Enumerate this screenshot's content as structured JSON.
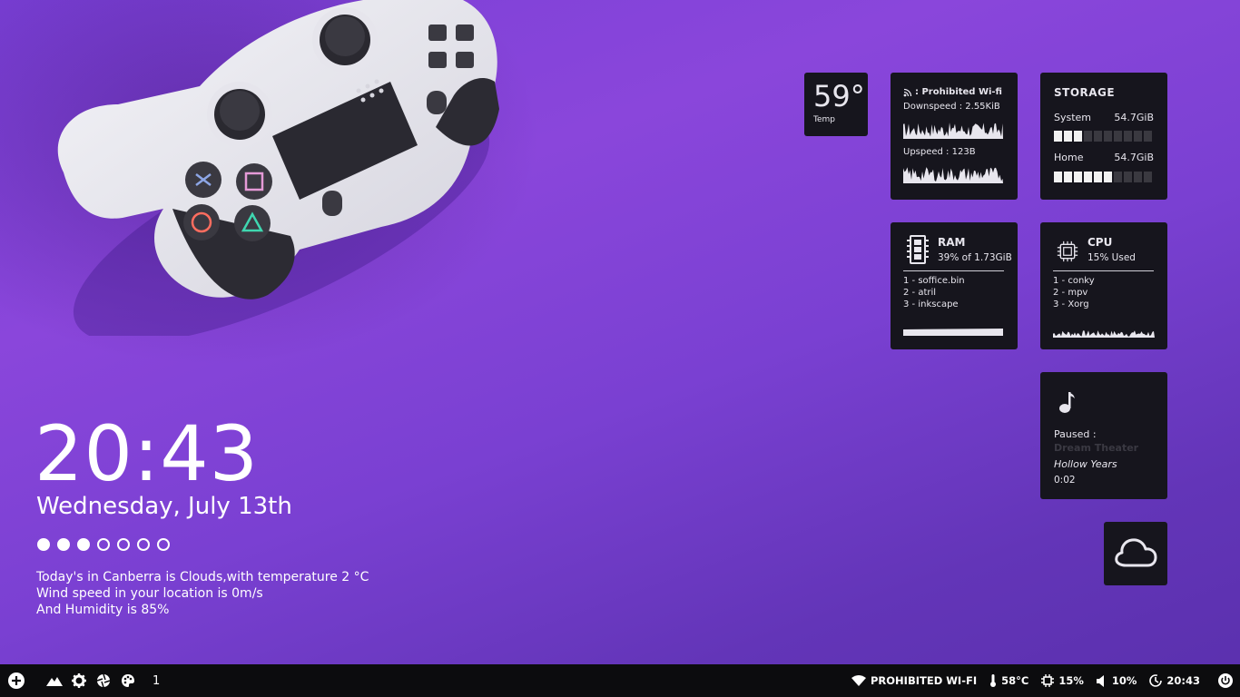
{
  "clock": {
    "time": "20:43",
    "date": "Wednesday, July 13th",
    "workspace_dots": [
      true,
      true,
      true,
      false,
      false,
      false,
      false
    ]
  },
  "weather_text": {
    "line1": "Today's in Canberra is Clouds,with temperature 2 °C",
    "line2": "Wind speed in your location is 0m/s",
    "line3": "And Humidity is 85%"
  },
  "temp_widget": {
    "value": "59°",
    "label": "Temp"
  },
  "network": {
    "ssid_label": ": Prohibited Wi-fi",
    "downspeed": "Downspeed : 2.55KiB",
    "upspeed": "Upspeed : 123B",
    "icon": "rss-wifi-icon"
  },
  "storage": {
    "title": "STORAGE",
    "system": {
      "label": "System",
      "value": "54.7GiB",
      "filled_segments": 3,
      "total_segments": 10
    },
    "home": {
      "label": "Home",
      "value": "54.7GiB",
      "filled_segments": 6,
      "total_segments": 10
    }
  },
  "ram": {
    "title": "RAM",
    "usage": "39% of 1.73GiB",
    "processes": [
      "1 - soffice.bin",
      "2 - atril",
      "3 - inkscape"
    ],
    "icon": "memory-icon"
  },
  "cpu": {
    "title": "CPU",
    "usage": "15% Used",
    "processes": [
      "1 - conky",
      "2 - mpv",
      "3 - Xorg"
    ],
    "icon": "chip-icon"
  },
  "music": {
    "status": "Paused :",
    "artist": "Dream Theater",
    "song": "Hollow Years",
    "time": "0:02",
    "icon": "music-note-icon"
  },
  "weather_widget": {
    "icon": "cloud-icon"
  },
  "taskbar": {
    "left_icons": [
      "add-circle-icon",
      "mountain-icon",
      "gear-icon",
      "aperture-icon",
      "palette-icon"
    ],
    "workspace": "1",
    "wifi": "PROHIBITED WI-FI",
    "temp": "58°C",
    "cpu": "15%",
    "volume": "10%",
    "clock": "20:43"
  }
}
